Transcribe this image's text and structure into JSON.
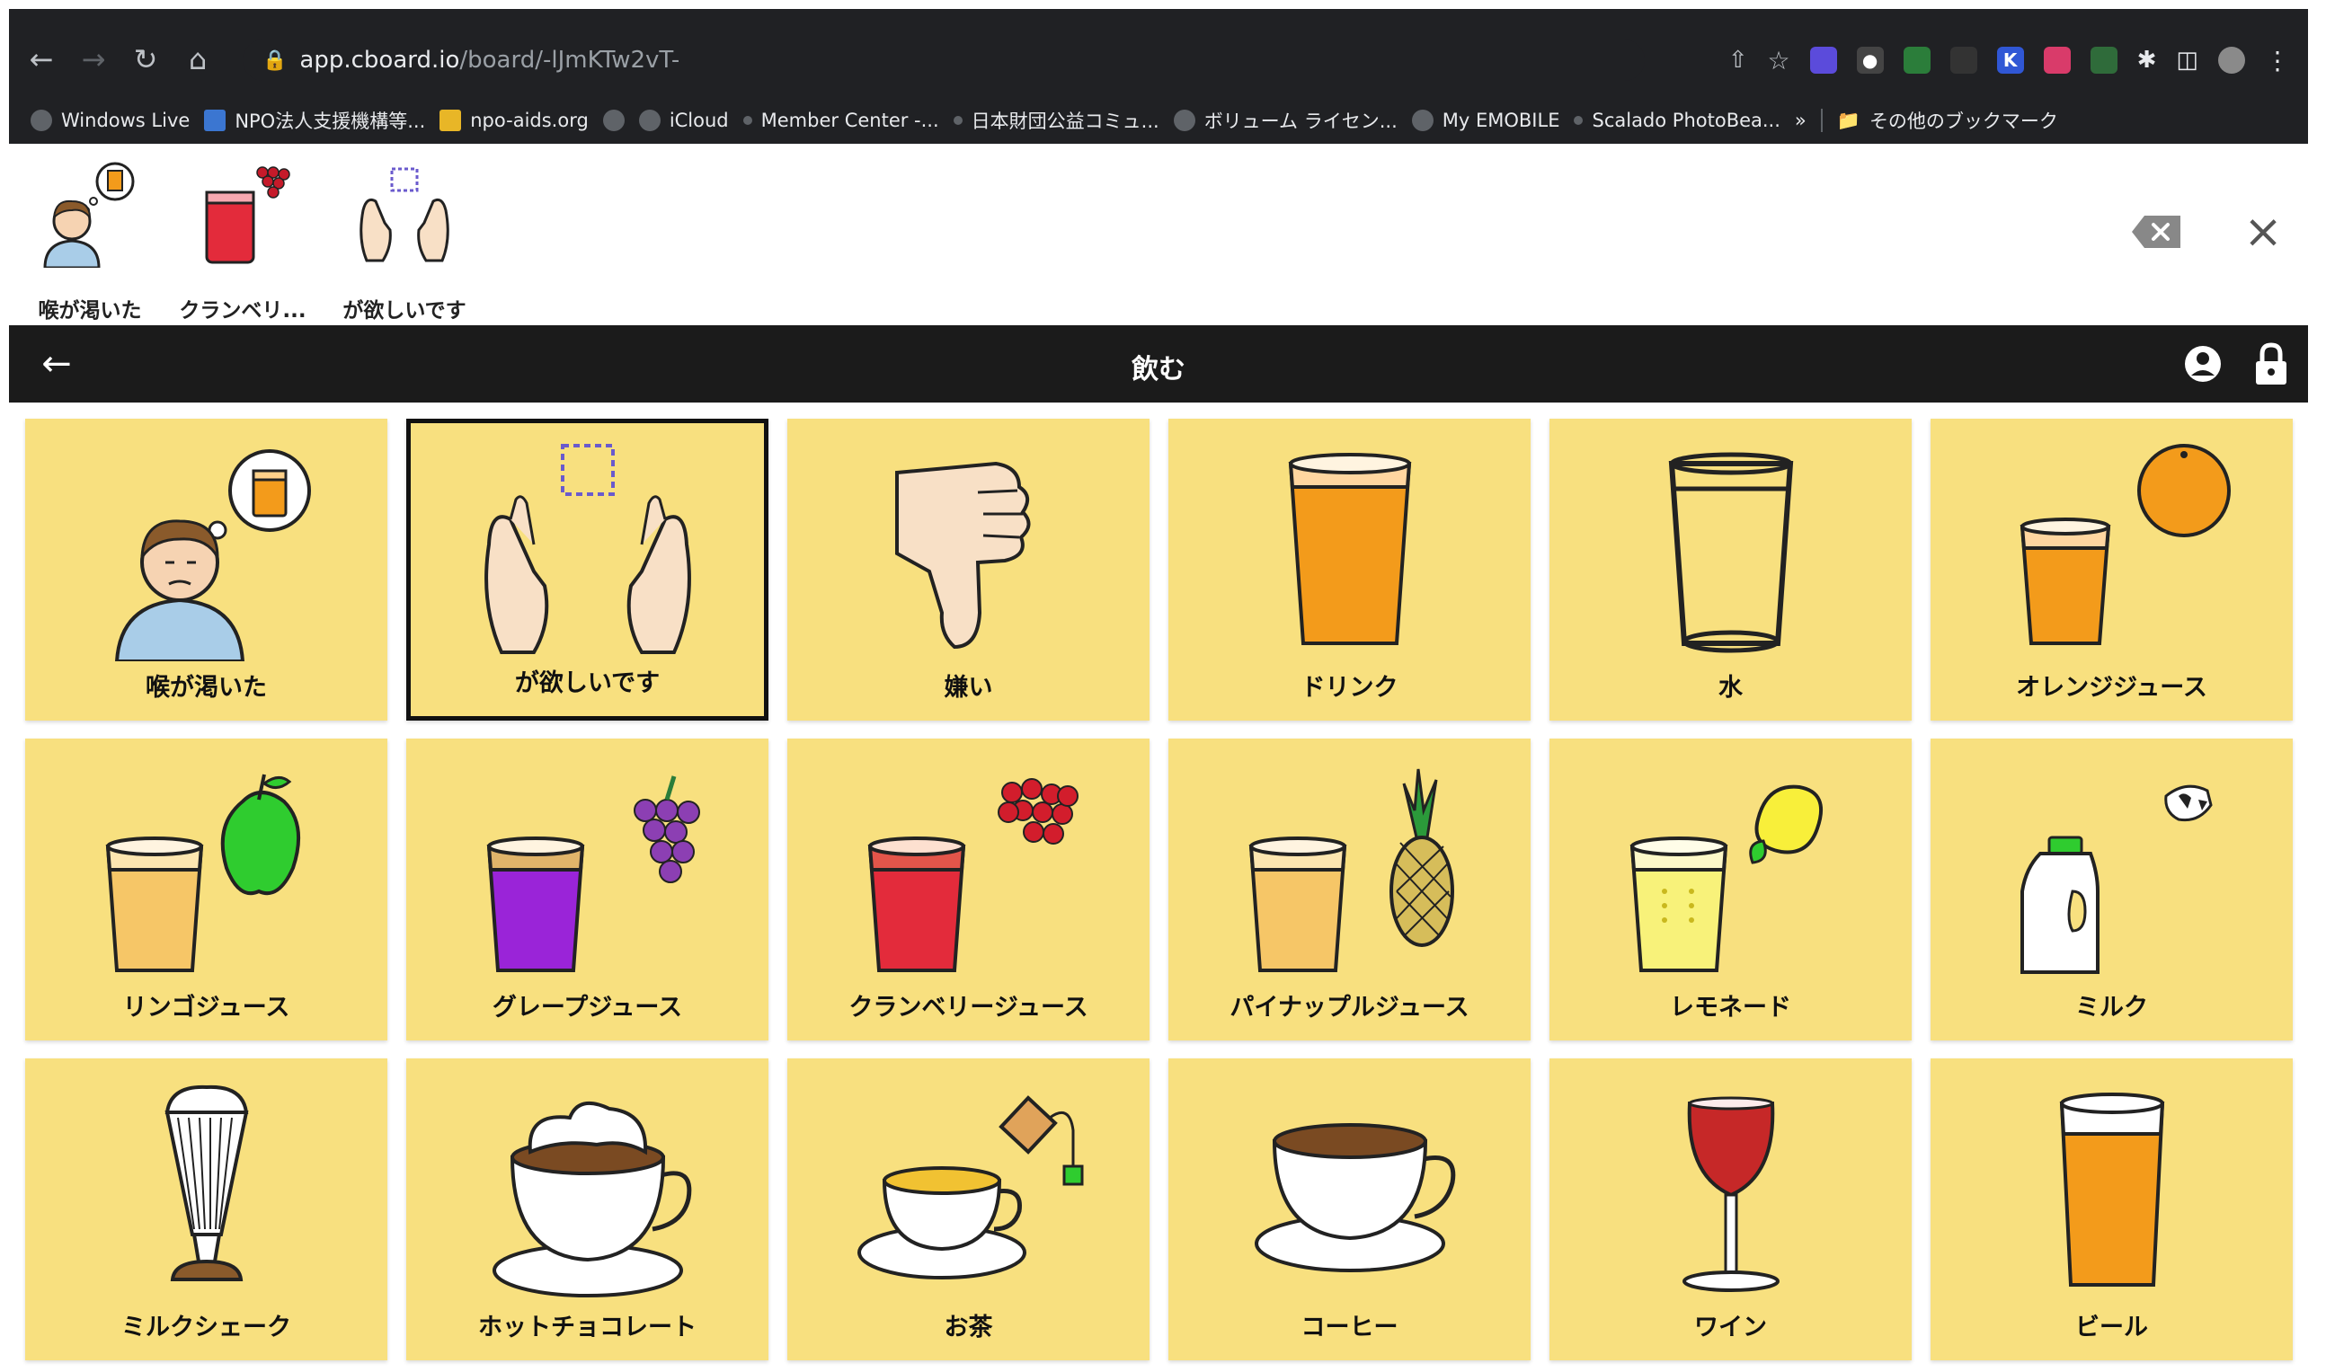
{
  "browser": {
    "url_host": "app.cboard.io",
    "url_path": "/board/-lJmKTw2vT-",
    "bookmarks": [
      {
        "label": "Windows Live"
      },
      {
        "label": "NPO法人支援機構等..."
      },
      {
        "label": "npo-aids.org"
      },
      {
        "label": "iCloud"
      },
      {
        "label": "Member Center -..."
      },
      {
        "label": "日本財団公益コミュ..."
      },
      {
        "label": "ボリューム ライセン..."
      },
      {
        "label": "My EMOBILE"
      },
      {
        "label": "Scalado PhotoBea..."
      },
      {
        "label": "その他のブックマーク"
      }
    ]
  },
  "output": {
    "items": [
      {
        "label": "喉が渇いた",
        "icon": "thirsty-icon"
      },
      {
        "label": "クランベリ...",
        "icon": "cranberry-juice-icon"
      },
      {
        "label": "が欲しいです",
        "icon": "want-icon"
      }
    ]
  },
  "board": {
    "title": "飲む",
    "tiles": [
      {
        "label": "喉が渇いた",
        "icon": "thirsty-icon"
      },
      {
        "label": "が欲しいです",
        "icon": "want-icon"
      },
      {
        "label": "嫌い",
        "icon": "thumbs-down-icon"
      },
      {
        "label": "ドリンク",
        "icon": "drink-icon"
      },
      {
        "label": "水",
        "icon": "water-icon"
      },
      {
        "label": "オレンジジュース",
        "icon": "orange-juice-icon"
      },
      {
        "label": "リンゴジュース",
        "icon": "apple-juice-icon"
      },
      {
        "label": "グレープジュース",
        "icon": "grape-juice-icon"
      },
      {
        "label": "クランベリージュース",
        "icon": "cranberry-juice-icon"
      },
      {
        "label": "パイナップルジュース",
        "icon": "pineapple-juice-icon"
      },
      {
        "label": "レモネード",
        "icon": "lemonade-icon"
      },
      {
        "label": "ミルク",
        "icon": "milk-icon"
      },
      {
        "label": "ミルクシェーク",
        "icon": "milkshake-icon"
      },
      {
        "label": "ホットチョコレート",
        "icon": "hot-chocolate-icon"
      },
      {
        "label": "お茶",
        "icon": "tea-icon"
      },
      {
        "label": "コーヒー",
        "icon": "coffee-icon"
      },
      {
        "label": "ワイン",
        "icon": "wine-icon"
      },
      {
        "label": "ビール",
        "icon": "beer-icon"
      }
    ]
  },
  "colors": {
    "tile": "#f8e07f",
    "header": "#1b1b1b",
    "chrome": "#202124"
  }
}
